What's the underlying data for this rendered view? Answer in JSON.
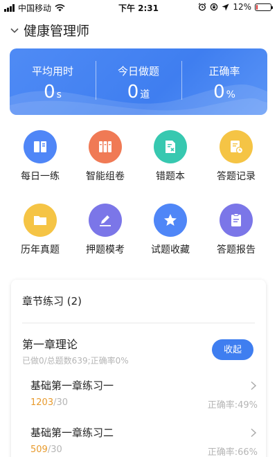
{
  "status_bar": {
    "carrier": "中国移动",
    "time": "下午 2:31",
    "battery": "12%",
    "battery_level": 0.12
  },
  "header": {
    "title": "健康管理师",
    "icon": "chevron-down-icon"
  },
  "stats": [
    {
      "label": "平均用时",
      "value": "0",
      "unit": "s"
    },
    {
      "label": "今日做题",
      "value": "0",
      "unit": "道"
    },
    {
      "label": "正确率",
      "value": "0",
      "unit": "%"
    }
  ],
  "features": [
    {
      "label": "每日一练",
      "icon": "book-icon",
      "color": "#4f86f7"
    },
    {
      "label": "智能组卷",
      "icon": "binders-icon",
      "color": "#f07a55"
    },
    {
      "label": "错题本",
      "icon": "wrong-doc-icon",
      "color": "#37c8b0"
    },
    {
      "label": "答题记录",
      "icon": "clock-doc-icon",
      "color": "#f5c445"
    },
    {
      "label": "历年真题",
      "icon": "folder-icon",
      "color": "#f5c445"
    },
    {
      "label": "押题模考",
      "icon": "pen-icon",
      "color": "#7b76e8"
    },
    {
      "label": "试题收藏",
      "icon": "star-icon",
      "color": "#4f86f7"
    },
    {
      "label": "答题报告",
      "icon": "clipboard-icon",
      "color": "#7b76e8"
    }
  ],
  "chapter_section": {
    "title": "章节练习 (2)",
    "chapter": {
      "name": "第一章理论",
      "meta": "已做0/总题数639;正确率0%",
      "collapse_label": "收起"
    },
    "exercises": [
      {
        "name": "基础第一章练习一",
        "done": "1203",
        "total": "/30",
        "accuracy": "正确率:49%"
      },
      {
        "name": "基础第一章练习二",
        "done": "509",
        "total": "/30",
        "accuracy": "正确率:66%"
      }
    ]
  }
}
